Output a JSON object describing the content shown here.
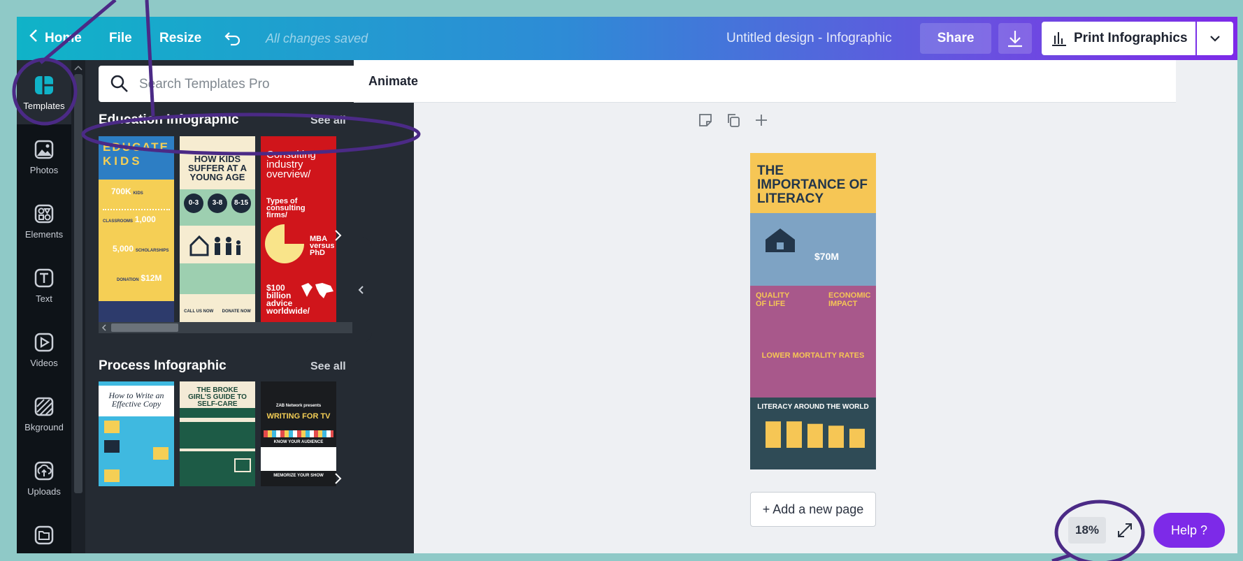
{
  "topbar": {
    "home": "Home",
    "file": "File",
    "resize": "Resize",
    "saved_status": "All changes saved",
    "design_title": "Untitled design - Infographic",
    "share": "Share",
    "print": "Print Infographics"
  },
  "rail": [
    {
      "label": "Templates",
      "icon": "templates-icon"
    },
    {
      "label": "Photos",
      "icon": "photos-icon"
    },
    {
      "label": "Elements",
      "icon": "elements-icon"
    },
    {
      "label": "Text",
      "icon": "text-icon"
    },
    {
      "label": "Videos",
      "icon": "videos-icon"
    },
    {
      "label": "Bkground",
      "icon": "background-icon"
    },
    {
      "label": "Uploads",
      "icon": "uploads-icon"
    }
  ],
  "search": {
    "placeholder": "Search Templates Pro"
  },
  "sections": [
    {
      "title": "Education Infographic",
      "see_all": "See all",
      "thumbs": [
        {
          "line1": "EDUCATE",
          "line2": "KIDS",
          "stats": [
            "700K",
            "1,000",
            "5,000",
            "$12M"
          ],
          "words": [
            "KIDS",
            "CLASSROOMS",
            "SCHOLARSHIPS",
            "DONATION"
          ]
        },
        {
          "title": "HOW KIDS SUFFER AT A YOUNG AGE",
          "ages": [
            "0-3",
            "3-8",
            "8-15"
          ],
          "call": "CALL US NOW",
          "donate": "DONATE NOW"
        },
        {
          "title": "Consulting industry overview/",
          "sub": "Types of consulting firms/",
          "mba": "MBA versus PhD",
          "money": "$100 billion advice worldwide/"
        }
      ]
    },
    {
      "title": "Process Infographic",
      "see_all": "See all",
      "thumbs": [
        {
          "title": "How to Write an Effective Copy"
        },
        {
          "title": "THE BROKE GIRL'S GUIDE TO SELF-CARE"
        },
        {
          "kicker": "ZAB Network presents",
          "title": "WRITING FOR TV",
          "sub": "KNOW YOUR AUDIENCE",
          "sub2": "MEMORIZE YOUR SHOW"
        }
      ]
    }
  ],
  "toolbar": {
    "animate": "Animate"
  },
  "page": {
    "title": "THE IMPORTANCE OF LITERACY",
    "stat": "$70M",
    "quality": "QUALITY OF LIFE",
    "economic": "ECONOMIC IMPACT",
    "mortality": "LOWER MORTALITY RATES",
    "world": "LITERACY AROUND THE WORLD",
    "bar_values": [
      0.86,
      0.86,
      0.78,
      0.72,
      0.62
    ]
  },
  "add_page": "+ Add a new page",
  "zoom": "18%",
  "help": "Help ?",
  "colors": {
    "accent": "#7d2ae8",
    "annotation": "#4b2a86"
  }
}
